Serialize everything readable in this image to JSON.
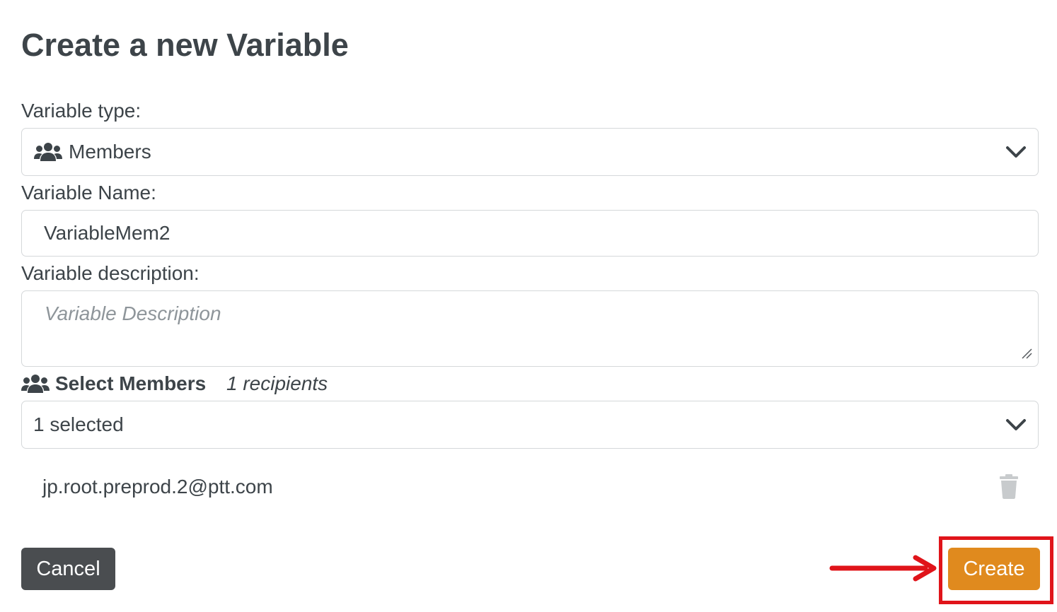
{
  "dialog": {
    "title": "Create a new Variable"
  },
  "variable_type": {
    "label": "Variable type:",
    "selected_value": "Members",
    "icon": "users-icon"
  },
  "variable_name": {
    "label": "Variable Name:",
    "value": "VariableMem2"
  },
  "variable_description": {
    "label": "Variable description:",
    "placeholder": "Variable Description",
    "value": ""
  },
  "select_members": {
    "heading": "Select Members",
    "count_text": "1 recipients",
    "icon": "users-icon",
    "dropdown_value": "1 selected",
    "members": [
      {
        "email": "jp.root.preprod.2@ptt.com"
      }
    ]
  },
  "footer": {
    "cancel_label": "Cancel",
    "create_label": "Create"
  },
  "colors": {
    "text": "#3d4449",
    "placeholder": "#8e959a",
    "field_border": "#d5d8da",
    "cancel_bg": "#4a4d50",
    "create_bg": "#e08a1e",
    "annotation": "#e0141a",
    "trash_icon": "#c8cbcd"
  }
}
